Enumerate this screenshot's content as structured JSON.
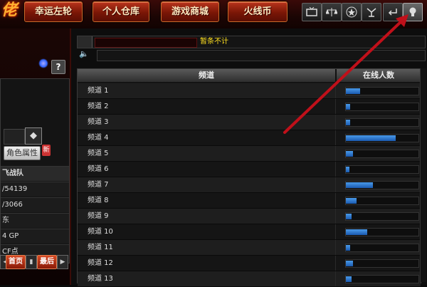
{
  "top_buttons": [
    "幸运左轮",
    "个人仓库",
    "游戏商城",
    "火线币"
  ],
  "logo_text": "佬",
  "icons": [
    "tv-icon",
    "scale-icon",
    "star-icon",
    "antenna-icon",
    "exit-icon",
    "lightbulb-icon",
    "settings-icon"
  ],
  "left_panel": {
    "help": "?",
    "tab_label": "角色属性",
    "badge": "新",
    "rows": [
      "飞战队",
      "/54139",
      "/3066",
      "东",
      "4 GP",
      "CF点"
    ],
    "page_prev": "首页",
    "page_last": "最后"
  },
  "chat": {
    "message": "暂条不计"
  },
  "table": {
    "col_channel": "频道",
    "col_online": "在线人数",
    "rows": [
      {
        "name": "频道 1",
        "load": 0.2
      },
      {
        "name": "频道 2",
        "load": 0.06
      },
      {
        "name": "频道 3",
        "load": 0.06
      },
      {
        "name": "频道 4",
        "load": 0.7
      },
      {
        "name": "频道 5",
        "load": 0.1
      },
      {
        "name": "频道 6",
        "load": 0.05
      },
      {
        "name": "频道 7",
        "load": 0.38
      },
      {
        "name": "频道 8",
        "load": 0.15
      },
      {
        "name": "频道 9",
        "load": 0.08
      },
      {
        "name": "频道 10",
        "load": 0.3
      },
      {
        "name": "频道 11",
        "load": 0.06
      },
      {
        "name": "频道 12",
        "load": 0.1
      },
      {
        "name": "频道 13",
        "load": 0.08
      }
    ]
  },
  "colors": {
    "accent_red": "#8a1a08",
    "bar_blue": "#3a8ae0",
    "arrow": "#c0101a"
  }
}
